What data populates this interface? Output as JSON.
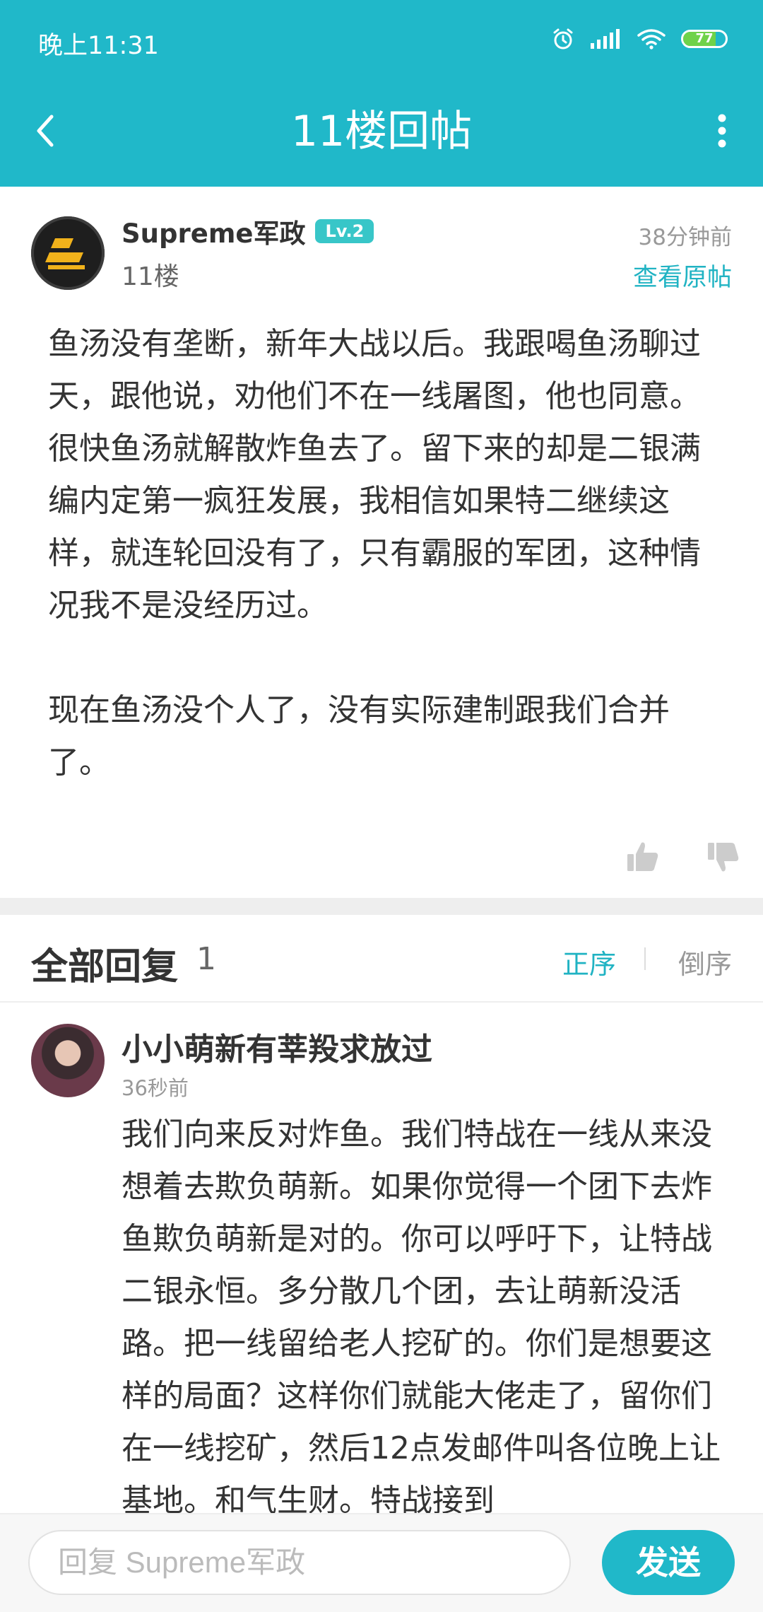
{
  "status_bar": {
    "time": "晚上11:31",
    "battery": "77",
    "battery_level": 0.77,
    "icons": [
      "alarm-icon",
      "signal-icon",
      "wifi-icon",
      "battery-icon"
    ]
  },
  "header": {
    "title": "11楼回帖",
    "back_icon": "chevron-left-icon",
    "more_icon": "more-vertical-icon"
  },
  "post": {
    "author": "Supreme军政",
    "level": "Lv.2",
    "floor": "11楼",
    "time": "38分钟前",
    "view_original": "查看原帖",
    "paragraphs": [
      "鱼汤没有垄断，新年大战以后。我跟喝鱼汤聊过天，跟他说，劝他们不在一线屠图，他也同意。很快鱼汤就解散炸鱼去了。留下来的却是二银满编内定第一疯狂发展，我相信如果特二继续这样，就连轮回没有了，只有霸服的军团，这种情况我不是没经历过。",
      "现在鱼汤没个人了，没有实际建制跟我们合并了。"
    ],
    "like_icon": "thumbs-up-icon",
    "dislike_icon": "thumbs-down-icon"
  },
  "replies_header": {
    "title": "全部回复",
    "count": "1",
    "sort_asc": "正序",
    "sort_desc": "倒序"
  },
  "reply": {
    "author": "小小萌新有莘羖求放过",
    "time": "36秒前",
    "text": "我们向来反对炸鱼。我们特战在一线从来没想着去欺负萌新。如果你觉得一个团下去炸鱼欺负萌新是对的。你可以呼吁下，让特战二银永恒。多分散几个团，去让萌新没活路。把一线留给老人挖矿的。你们是想要这样的局面？这样你们就能大佬走了，留你们在一线挖矿，然后12点发邮件叫各位晚上让基地。和气生财。特战接到"
  },
  "compose": {
    "placeholder": "回复 Supreme军政",
    "send_label": "发送"
  },
  "colors": {
    "accent": "#20b8c9",
    "link": "#20b3c3",
    "level_badge": "#38c6c8"
  }
}
